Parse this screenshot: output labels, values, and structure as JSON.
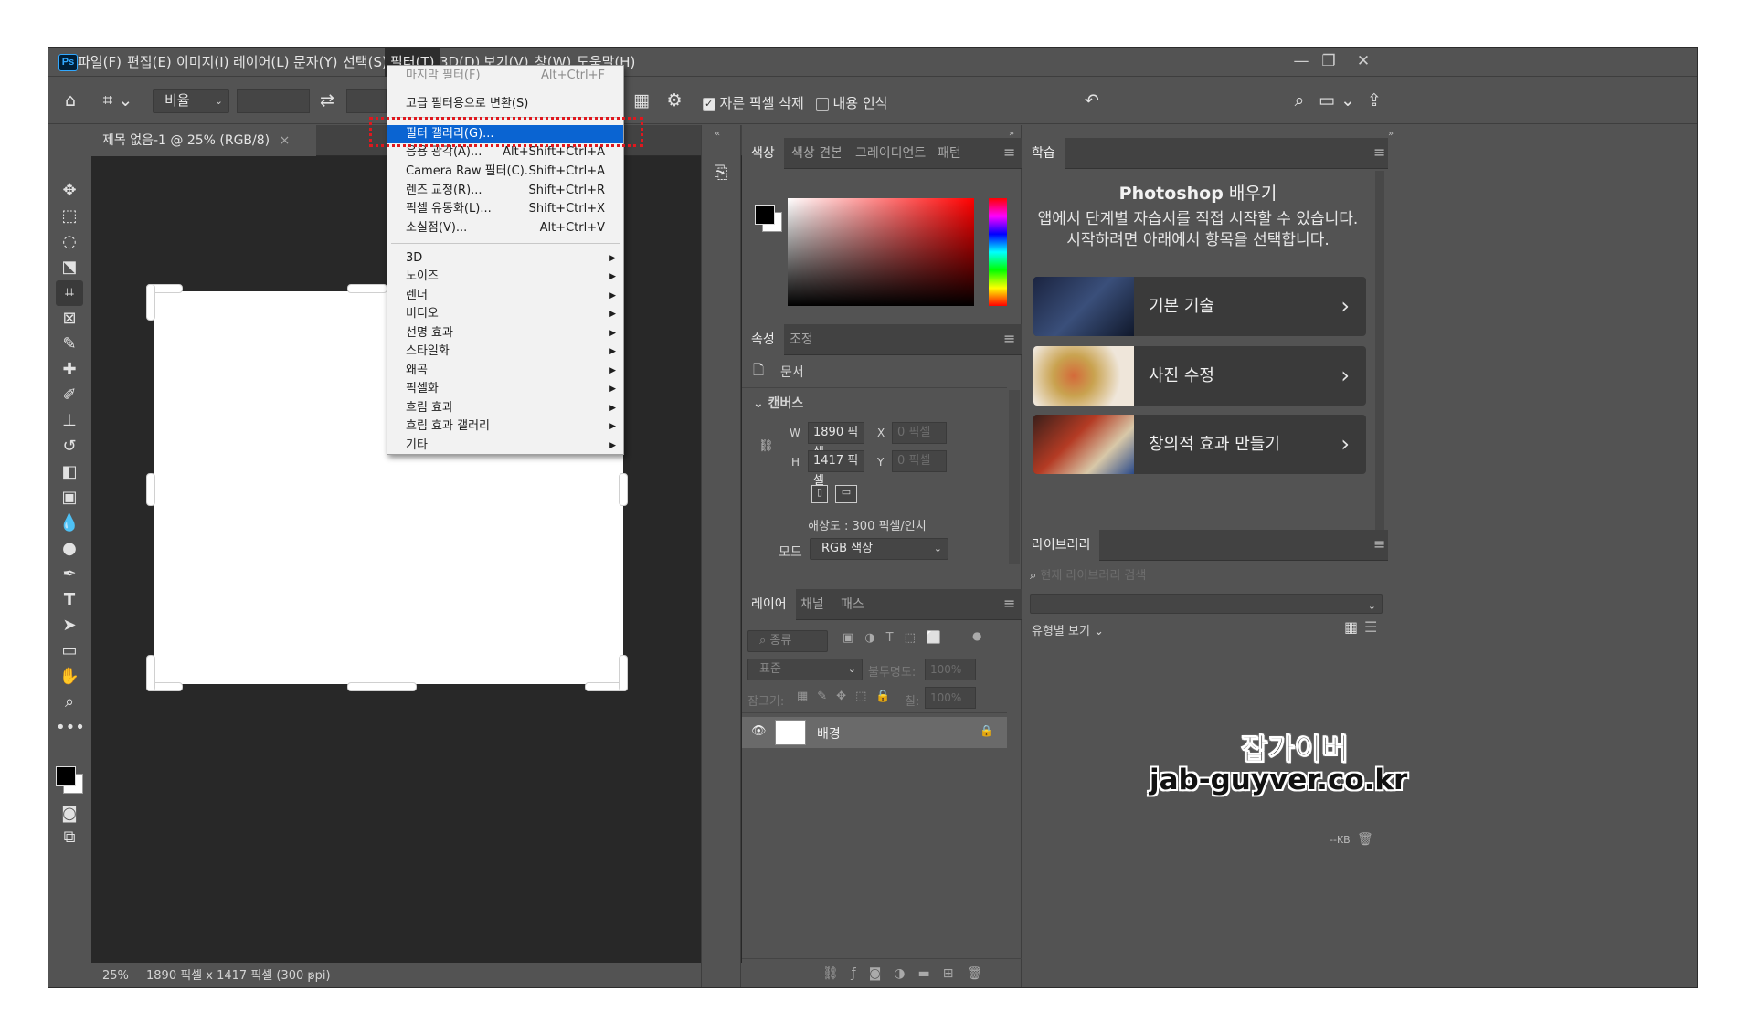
{
  "app": {
    "logo": "Ps"
  },
  "menubar": {
    "items": [
      "파일(F)",
      "편집(E)",
      "이미지(I)",
      "레이어(L)",
      "문자(Y)",
      "선택(S)",
      "필터(T)",
      "3D(D)",
      "보기(V)",
      "창(W)",
      "도움말(H)"
    ],
    "window_controls": {
      "minimize": "—",
      "restore": "❐",
      "close": "✕"
    }
  },
  "options": {
    "ratio_select": "비율",
    "delete_cropped_label": "자른 픽셀 삭제",
    "content_aware_label": "내용 인식",
    "icons": [
      "home-icon",
      "crop-tool-icon",
      "swap-icon",
      "grid-overlay-icon",
      "gear-icon",
      "undo-reset-icon",
      "search-icon",
      "workspace-icon",
      "share-icon"
    ]
  },
  "document": {
    "tab_title": "제목 없음-1 @ 25% (RGB/8)",
    "tab_close": "×",
    "zoom": "25%",
    "info": "1890 픽셀 x 1417 픽셀 (300 ppi)",
    "info_arrow": "›"
  },
  "filter_menu": {
    "items": [
      {
        "label": "마지막 필터(F)",
        "shortcut": "Alt+Ctrl+F",
        "disabled": true
      },
      {
        "label": "고급 필터용으로 변환(S)",
        "shortcut": ""
      },
      {
        "label": "필터 갤러리(G)...",
        "shortcut": "",
        "highlighted": true
      },
      {
        "label": "응용 광각(A)...",
        "shortcut": "Alt+Shift+Ctrl+A"
      },
      {
        "label": "Camera Raw 필터(C)...",
        "shortcut": "Shift+Ctrl+A"
      },
      {
        "label": "렌즈 교정(R)...",
        "shortcut": "Shift+Ctrl+R"
      },
      {
        "label": "픽셀 유동화(L)...",
        "shortcut": "Shift+Ctrl+X"
      },
      {
        "label": "소실점(V)...",
        "shortcut": "Alt+Ctrl+V"
      }
    ],
    "submenus": [
      "3D",
      "노이즈",
      "렌더",
      "비디오",
      "선명 효과",
      "스타일화",
      "왜곡",
      "픽셀화",
      "흐림 효과",
      "흐림 효과 갤러리",
      "기타"
    ],
    "submenu_arrow": "▶"
  },
  "color_panel": {
    "tabs": [
      "색상",
      "색상 견본",
      "그레이디언트",
      "패턴"
    ],
    "foreground": "#000000",
    "background": "#ffffff",
    "hue": "#ff0000"
  },
  "properties_panel": {
    "tabs": [
      "속성",
      "조정"
    ],
    "doc_label": "문서",
    "section": "캔버스",
    "w_label": "W",
    "w_value": "1890 픽셀",
    "h_label": "H",
    "h_value": "1417 픽셀",
    "x_label": "X",
    "x_value": "0 픽셀",
    "y_label": "Y",
    "y_value": "0 픽셀",
    "resolution": "해상도 : 300 픽셀/인치",
    "mode_label": "모드",
    "mode_value": "RGB 색상"
  },
  "layers_panel": {
    "tabs": [
      "레이어",
      "채널",
      "패스"
    ],
    "kind_label": "종류",
    "blend_mode": "표준",
    "opacity_label": "불투명도:",
    "opacity_value": "100%",
    "lock_label": "잠그기:",
    "fill_label": "칠:",
    "fill_value": "100%",
    "layer_name": "배경",
    "footer_icons": [
      "link-icon",
      "fx-icon",
      "mask-icon",
      "adjustment-icon",
      "folder-icon",
      "new-layer-icon",
      "trash-icon"
    ]
  },
  "learn_panel": {
    "tab": "학습",
    "title_brand": "Photoshop",
    "title_rest": "배우기",
    "description": "앱에서 단계별 자습서를 직접 시작할 수 있습니다. 시작하려면 아래에서 항목을 선택합니다.",
    "cards": [
      "기본 기술",
      "사진 수정",
      "창의적 효과 만들기"
    ],
    "card_arrow": "›"
  },
  "libraries_panel": {
    "tab": "라이브러리",
    "search_placeholder": "현재 라이브러리 검색",
    "view_label": "유형별 보기",
    "size": "--KB"
  },
  "watermark": {
    "line1": "잡가이버",
    "line2": "jab-guyver.co.kr"
  }
}
